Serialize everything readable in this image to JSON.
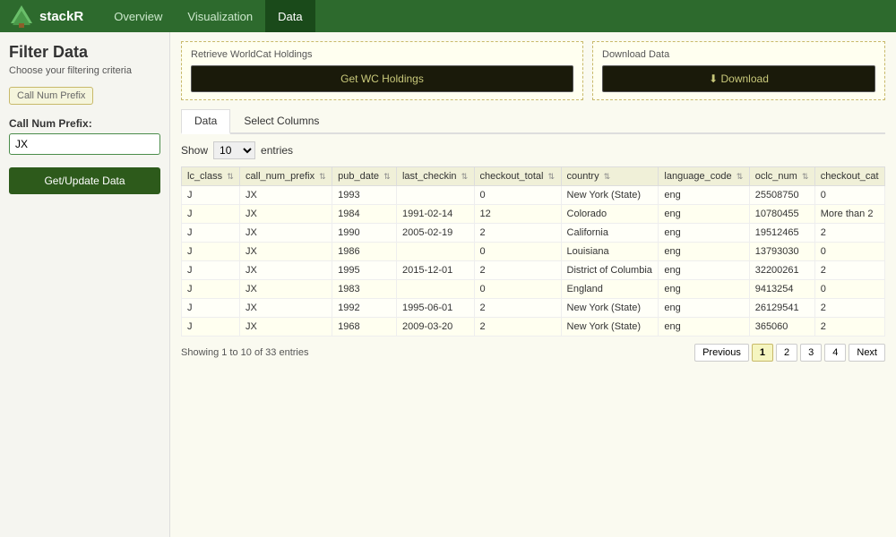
{
  "app": {
    "brand": "stackR",
    "nav_items": [
      "Overview",
      "Visualization",
      "Data"
    ],
    "active_nav": "Data"
  },
  "sidebar": {
    "title": "Filter Data",
    "subtitle": "Choose your filtering criteria",
    "filter_tag": "Call Num Prefix",
    "call_num_label": "Call Num Prefix:",
    "call_num_value": "JX",
    "update_button": "Get/Update Data"
  },
  "wc_panel": {
    "label": "Retrieve WorldCat Holdings",
    "button": "Get WC Holdings"
  },
  "download_panel": {
    "label": "Download Data",
    "button": "⬇ Download"
  },
  "tabs": [
    "Data",
    "Select Columns"
  ],
  "active_tab": "Data",
  "show_entries": {
    "label_before": "Show",
    "value": "10",
    "label_after": "entries"
  },
  "table": {
    "columns": [
      "lc_class",
      "call_num_prefix",
      "pub_date",
      "last_checkin",
      "checkout_total",
      "country",
      "language_code",
      "oclc_num",
      "checkout_cat"
    ],
    "rows": [
      {
        "lc_class": "J",
        "call_num_prefix": "JX",
        "pub_date": "1993",
        "last_checkin": "",
        "checkout_total": "0",
        "country": "New York (State)",
        "language_code": "eng",
        "oclc_num": "25508750",
        "checkout_cat": "0"
      },
      {
        "lc_class": "J",
        "call_num_prefix": "JX",
        "pub_date": "1984",
        "last_checkin": "1991-02-14",
        "checkout_total": "12",
        "country": "Colorado",
        "language_code": "eng",
        "oclc_num": "10780455",
        "checkout_cat": "More than 2"
      },
      {
        "lc_class": "J",
        "call_num_prefix": "JX",
        "pub_date": "1990",
        "last_checkin": "2005-02-19",
        "checkout_total": "2",
        "country": "California",
        "language_code": "eng",
        "oclc_num": "19512465",
        "checkout_cat": "2"
      },
      {
        "lc_class": "J",
        "call_num_prefix": "JX",
        "pub_date": "1986",
        "last_checkin": "",
        "checkout_total": "0",
        "country": "Louisiana",
        "language_code": "eng",
        "oclc_num": "13793030",
        "checkout_cat": "0"
      },
      {
        "lc_class": "J",
        "call_num_prefix": "JX",
        "pub_date": "1995",
        "last_checkin": "2015-12-01",
        "checkout_total": "2",
        "country": "District of Columbia",
        "language_code": "eng",
        "oclc_num": "32200261",
        "checkout_cat": "2"
      },
      {
        "lc_class": "J",
        "call_num_prefix": "JX",
        "pub_date": "1983",
        "last_checkin": "",
        "checkout_total": "0",
        "country": "England",
        "language_code": "eng",
        "oclc_num": "9413254",
        "checkout_cat": "0"
      },
      {
        "lc_class": "J",
        "call_num_prefix": "JX",
        "pub_date": "1992",
        "last_checkin": "1995-06-01",
        "checkout_total": "2",
        "country": "New York (State)",
        "language_code": "eng",
        "oclc_num": "26129541",
        "checkout_cat": "2"
      },
      {
        "lc_class": "J",
        "call_num_prefix": "JX",
        "pub_date": "1968",
        "last_checkin": "2009-03-20",
        "checkout_total": "2",
        "country": "New York (State)",
        "language_code": "eng",
        "oclc_num": "365060",
        "checkout_cat": "2"
      }
    ]
  },
  "footer": {
    "showing": "Showing 1 to 10 of 33 entries",
    "pagination": [
      "Previous",
      "1",
      "2",
      "3",
      "4",
      "Next"
    ]
  }
}
